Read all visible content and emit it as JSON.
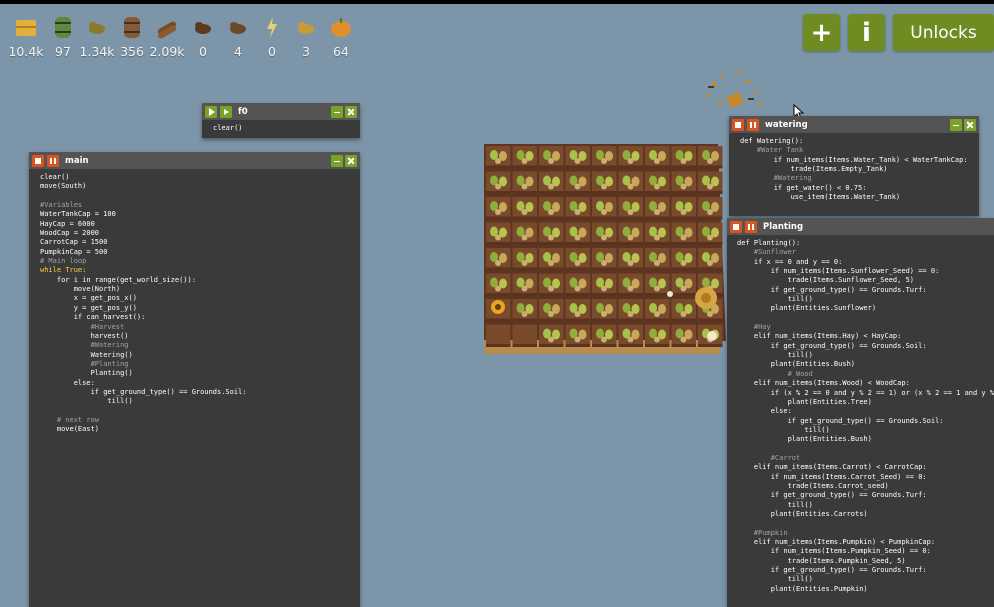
{
  "resources": [
    {
      "icon": "hay-icon",
      "value": "10.4k",
      "color": "#e3b03c"
    },
    {
      "icon": "water-barrel-icon",
      "value": "97",
      "color": "#5f8a3a"
    },
    {
      "icon": "bush-icon",
      "value": "1.34k",
      "color": "#8a7a2a"
    },
    {
      "icon": "wood-barrel-icon",
      "value": "356",
      "color": "#8a5a30"
    },
    {
      "icon": "wood-logs-icon",
      "value": "2.09k",
      "color": "#7a4a25"
    },
    {
      "icon": "seed-icon",
      "value": "0",
      "color": "#5b3a20"
    },
    {
      "icon": "carrot-seed-icon",
      "value": "4",
      "color": "#6b4a2a"
    },
    {
      "icon": "power-icon",
      "value": "0",
      "color": "#e8d070"
    },
    {
      "icon": "pumpkin-seed-icon",
      "value": "3",
      "color": "#c89a3a"
    },
    {
      "icon": "pumpkin-icon",
      "value": "64",
      "color": "#e0902a"
    }
  ],
  "buttons": {
    "add": "+",
    "info": "i",
    "unlocks": "Unlocks"
  },
  "windows": {
    "f0": {
      "title": "f0",
      "lines": [
        {
          "t": "clear()",
          "c": ""
        }
      ]
    },
    "main": {
      "title": "main",
      "lines": [
        {
          "t": "clear()",
          "c": ""
        },
        {
          "t": "move(South)",
          "c": ""
        },
        {
          "t": "",
          "c": ""
        },
        {
          "t": "#Variables",
          "c": "cmt"
        },
        {
          "t": "WaterTankCap = 100",
          "c": ""
        },
        {
          "t": "HayCap = 6000",
          "c": ""
        },
        {
          "t": "WoodCap = 2000",
          "c": ""
        },
        {
          "t": "CarrotCap = 1500",
          "c": ""
        },
        {
          "t": "PumpkinCap = 500",
          "c": ""
        },
        {
          "t": "# Main loop",
          "c": "cmt"
        },
        {
          "t": "while True:",
          "c": "kw"
        },
        {
          "t": "    for i in range(get_world_size()):",
          "c": ""
        },
        {
          "t": "        move(North)",
          "c": ""
        },
        {
          "t": "        x = get_pos_x()",
          "c": ""
        },
        {
          "t": "        y = get_pos_y()",
          "c": ""
        },
        {
          "t": "        if can_harvest():",
          "c": ""
        },
        {
          "t": "            #Harvest",
          "c": "cmt"
        },
        {
          "t": "            harvest()",
          "c": ""
        },
        {
          "t": "            #Watering",
          "c": "cmt"
        },
        {
          "t": "            Watering()",
          "c": ""
        },
        {
          "t": "            #Planting",
          "c": "cmt"
        },
        {
          "t": "            Planting()",
          "c": ""
        },
        {
          "t": "        else:",
          "c": ""
        },
        {
          "t": "            if get_ground_type() == Grounds.Soil:",
          "c": ""
        },
        {
          "t": "                till()",
          "c": ""
        },
        {
          "t": "",
          "c": ""
        },
        {
          "t": "    # next row",
          "c": "cmt"
        },
        {
          "t": "    move(East)",
          "c": ""
        }
      ]
    },
    "watering": {
      "title": "watering",
      "lines": [
        {
          "t": "def Watering():",
          "c": ""
        },
        {
          "t": "    #Water Tank",
          "c": "cmt"
        },
        {
          "t": "        if num_items(Items.Water_Tank) < WaterTankCap:",
          "c": ""
        },
        {
          "t": "            trade(Items.Empty_Tank)",
          "c": ""
        },
        {
          "t": "        #Watering",
          "c": "cmt"
        },
        {
          "t": "        if get_water() < 0.75:",
          "c": ""
        },
        {
          "t": "            use_item(Items.Water_Tank)",
          "c": ""
        }
      ]
    },
    "planting": {
      "title": "Planting",
      "lines": [
        {
          "t": "def Planting():",
          "c": ""
        },
        {
          "t": "    #Sunflower",
          "c": "cmt"
        },
        {
          "t": "    if x == 0 and y == 0:",
          "c": ""
        },
        {
          "t": "        if num_items(Items.Sunflower_Seed) == 0:",
          "c": ""
        },
        {
          "t": "            trade(Items.Sunflower_Seed, 5)",
          "c": ""
        },
        {
          "t": "        if get_ground_type() == Grounds.Turf:",
          "c": ""
        },
        {
          "t": "            till()",
          "c": ""
        },
        {
          "t": "        plant(Entities.Sunflower)",
          "c": ""
        },
        {
          "t": "",
          "c": ""
        },
        {
          "t": "    #Hay",
          "c": "cmt"
        },
        {
          "t": "    elif num_items(Items.Hay) < HayCap:",
          "c": ""
        },
        {
          "t": "        if get_ground_type() == Grounds.Soil:",
          "c": ""
        },
        {
          "t": "            till()",
          "c": ""
        },
        {
          "t": "        plant(Entities.Bush)",
          "c": ""
        },
        {
          "t": "            # Wood",
          "c": "cmt"
        },
        {
          "t": "    elif num_items(Items.Wood) < WoodCap:",
          "c": ""
        },
        {
          "t": "        if (x % 2 == 0 and y % 2 == 1) or (x % 2 == 1 and y % 2",
          "c": ""
        },
        {
          "t": "            plant(Entities.Tree)",
          "c": ""
        },
        {
          "t": "        else:",
          "c": ""
        },
        {
          "t": "            if get_ground_type() == Grounds.Soil:",
          "c": ""
        },
        {
          "t": "                till()",
          "c": ""
        },
        {
          "t": "            plant(Entities.Bush)",
          "c": ""
        },
        {
          "t": "",
          "c": ""
        },
        {
          "t": "        #Carrot",
          "c": "cmt"
        },
        {
          "t": "    elif num_items(Items.Carrot) < CarrotCap:",
          "c": ""
        },
        {
          "t": "        if num_items(Items.Carrot_Seed) == 0:",
          "c": ""
        },
        {
          "t": "            trade(Items.Carrot_seed)",
          "c": ""
        },
        {
          "t": "        if get_ground_type() == Grounds.Turf:",
          "c": ""
        },
        {
          "t": "            till()",
          "c": ""
        },
        {
          "t": "        plant(Entities.Carrots)",
          "c": ""
        },
        {
          "t": "",
          "c": ""
        },
        {
          "t": "    #Pumpkin",
          "c": "cmt"
        },
        {
          "t": "    elif num_items(Items.Pumpkin) < PumpkinCap:",
          "c": ""
        },
        {
          "t": "        if num_items(Items.Pumpkin_Seed) == 0:",
          "c": ""
        },
        {
          "t": "            trade(Items.Pumpkin_Seed, 5)",
          "c": ""
        },
        {
          "t": "        if get_ground_type() == Grounds.Turf:",
          "c": ""
        },
        {
          "t": "            till()",
          "c": ""
        },
        {
          "t": "        plant(Entities.Pumpkin)",
          "c": ""
        }
      ]
    }
  },
  "field": {
    "rows": 8,
    "cols": 9,
    "sunflower_cell": "row 7, col 0"
  }
}
